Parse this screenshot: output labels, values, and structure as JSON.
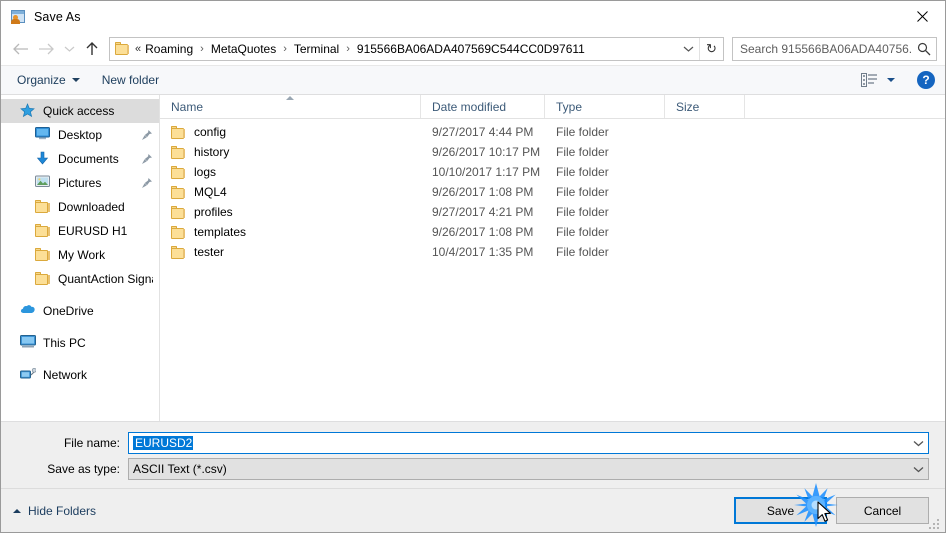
{
  "window": {
    "title": "Save As",
    "icon": "save-as-app-icon",
    "close_label": "✕"
  },
  "navbar": {
    "back_icon": "back-arrow-icon",
    "forward_icon": "forward-arrow-icon",
    "recent_icon": "recent-locations-chevron-icon",
    "up_icon": "up-arrow-icon",
    "address": {
      "folder_icon": "folder-icon",
      "lead_separator": "«",
      "crumbs": [
        "Roaming",
        "MetaQuotes",
        "Terminal",
        "915566BA06ADA407569C544CC0D97611"
      ],
      "separator": "›",
      "dropdown_icon": "chevron-down-icon",
      "refresh_icon": "refresh-icon",
      "refresh_glyph": "↻"
    },
    "search": {
      "placeholder": "Search 915566BA06ADA40756...",
      "icon": "search-icon"
    }
  },
  "commandbar": {
    "organize_label": "Organize",
    "new_folder_label": "New folder",
    "view_icon": "view-options-icon",
    "view_caret_icon": "chevron-down-icon",
    "help_label": "?",
    "help_icon": "help-icon"
  },
  "sidebar": {
    "items": [
      {
        "label": "Quick access",
        "icon": "star-icon",
        "level": 0,
        "selected": true,
        "pinned": false
      },
      {
        "label": "Desktop",
        "icon": "desktop-icon",
        "level": 1,
        "selected": false,
        "pinned": true
      },
      {
        "label": "Documents",
        "icon": "documents-download-icon",
        "level": 1,
        "selected": false,
        "pinned": true
      },
      {
        "label": "Pictures",
        "icon": "pictures-icon",
        "level": 1,
        "selected": false,
        "pinned": true
      },
      {
        "label": "Downloaded",
        "icon": "folder-icon",
        "level": 1,
        "selected": false,
        "pinned": false
      },
      {
        "label": "EURUSD H1",
        "icon": "folder-icon",
        "level": 1,
        "selected": false,
        "pinned": false
      },
      {
        "label": "My Work",
        "icon": "folder-icon",
        "level": 1,
        "selected": false,
        "pinned": false
      },
      {
        "label": "QuantAction Signal",
        "icon": "folder-icon",
        "level": 1,
        "selected": false,
        "pinned": false
      },
      {
        "label": "",
        "icon": "spacer",
        "level": 0,
        "selected": false,
        "pinned": false,
        "spacer": true
      },
      {
        "label": "OneDrive",
        "icon": "onedrive-cloud-icon",
        "level": 0,
        "selected": false,
        "pinned": false
      },
      {
        "label": "",
        "icon": "spacer",
        "level": 0,
        "selected": false,
        "pinned": false,
        "spacer": true
      },
      {
        "label": "This PC",
        "icon": "this-pc-icon",
        "level": 0,
        "selected": false,
        "pinned": false
      },
      {
        "label": "",
        "icon": "spacer",
        "level": 0,
        "selected": false,
        "pinned": false,
        "spacer": true
      },
      {
        "label": "Network",
        "icon": "network-icon",
        "level": 0,
        "selected": false,
        "pinned": false
      }
    ]
  },
  "filelist": {
    "columns": [
      {
        "key": "name",
        "label": "Name",
        "sorted": "asc"
      },
      {
        "key": "date",
        "label": "Date modified",
        "sorted": ""
      },
      {
        "key": "type",
        "label": "Type",
        "sorted": ""
      },
      {
        "key": "size",
        "label": "Size",
        "sorted": ""
      }
    ],
    "rows": [
      {
        "icon": "folder-icon",
        "name": "config",
        "date": "9/27/2017 4:44 PM",
        "type": "File folder",
        "size": ""
      },
      {
        "icon": "folder-icon",
        "name": "history",
        "date": "9/26/2017 10:17 PM",
        "type": "File folder",
        "size": ""
      },
      {
        "icon": "folder-icon",
        "name": "logs",
        "date": "10/10/2017 1:17 PM",
        "type": "File folder",
        "size": ""
      },
      {
        "icon": "folder-icon",
        "name": "MQL4",
        "date": "9/26/2017 1:08 PM",
        "type": "File folder",
        "size": ""
      },
      {
        "icon": "folder-icon",
        "name": "profiles",
        "date": "9/27/2017 4:21 PM",
        "type": "File folder",
        "size": ""
      },
      {
        "icon": "folder-icon",
        "name": "templates",
        "date": "9/26/2017 1:08 PM",
        "type": "File folder",
        "size": ""
      },
      {
        "icon": "folder-icon",
        "name": "tester",
        "date": "10/4/2017 1:35 PM",
        "type": "File folder",
        "size": ""
      }
    ]
  },
  "fields": {
    "filename_label": "File name:",
    "filename_value": "EURUSD2",
    "filename_selected": true,
    "savetype_label": "Save as type:",
    "savetype_value": "ASCII Text (*.csv)",
    "dropdown_icon": "chevron-down-icon"
  },
  "footer": {
    "hide_folders_label": "Hide Folders",
    "hide_folders_icon": "chevron-up-icon",
    "save_label": "Save",
    "cancel_label": "Cancel",
    "resize_grip_icon": "resize-grip-icon"
  },
  "pointer": {
    "cursor_icon": "arrow-cursor",
    "click_effect_icon": "click-sparkle-icon",
    "click_color": "#1e90ff"
  },
  "colors": {
    "accent": "#0078d7",
    "selection": "#0078d7",
    "folder": "#fcdf97",
    "help_blue": "#1565c0",
    "chrome": "#efefef"
  }
}
